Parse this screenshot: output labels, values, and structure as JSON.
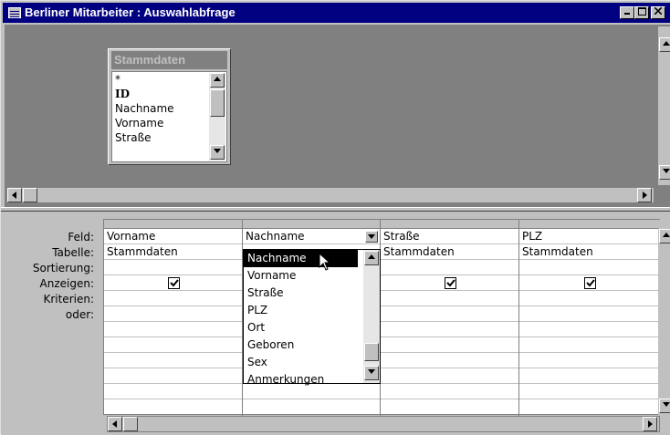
{
  "window": {
    "title": "Berliner Mitarbeiter : Auswahlabfrage",
    "min_label": "_",
    "max_label": "□",
    "close_label": "✕"
  },
  "field_list": {
    "title": "Stammdaten",
    "items": [
      "*",
      "ID",
      "Nachname",
      "Vorname",
      "Straße"
    ]
  },
  "grid_row_labels": [
    "Feld:",
    "Tabelle:",
    "Sortierung:",
    "Anzeigen:",
    "Kriterien:",
    "oder:"
  ],
  "grid_columns": [
    {
      "feld": "Vorname",
      "tabelle": "Stammdaten",
      "anzeigen": true
    },
    {
      "feld": "Nachname",
      "tabelle": "Nachname",
      "anzeigen": true
    },
    {
      "feld": "Straße",
      "tabelle": "Stammdaten",
      "anzeigen": true
    },
    {
      "feld": "PLZ",
      "tabelle": "Stammdaten",
      "anzeigen": true
    }
  ],
  "dropdown": {
    "selected": "Nachname",
    "options": [
      "Nachname",
      "Vorname",
      "Straße",
      "PLZ",
      "Ort",
      "Geboren",
      "Sex",
      "Anmerkungen"
    ]
  },
  "colors": {
    "titlebar": "#000080",
    "face": "#c0c0c0",
    "selection": "#000000"
  }
}
